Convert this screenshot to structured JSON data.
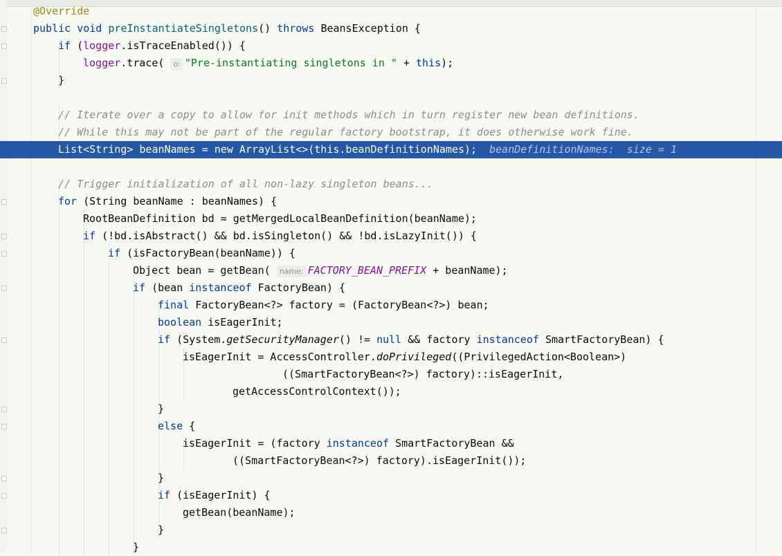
{
  "editor": {
    "language": "Java",
    "current_line_color": "#2557a6",
    "lines": [
      {
        "name": "line-override",
        "indent": 0,
        "tokens": [
          [
            "a",
            "@Override"
          ]
        ]
      },
      {
        "name": "line-method-signature",
        "indent": 0,
        "tokens": [
          [
            "k",
            "public "
          ],
          [
            "k",
            "void "
          ],
          [
            "f",
            "preInstantiateSingletons"
          ],
          [
            "",
            "() "
          ],
          [
            "k",
            "throws "
          ],
          [
            "",
            "BeansException {"
          ]
        ]
      },
      {
        "name": "line-if-trace",
        "indent": 1,
        "tokens": [
          [
            "k",
            "if "
          ],
          [
            "",
            "("
          ],
          [
            "fld",
            "logger"
          ],
          [
            "",
            ".isTraceEnabled()) {"
          ]
        ]
      },
      {
        "name": "line-logger-trace",
        "indent": 2,
        "tokens": [
          [
            "fld",
            "logger"
          ],
          [
            "",
            ".trace( "
          ],
          [
            "hint",
            "o:"
          ],
          [
            "s",
            "\"Pre-instantiating singletons in \""
          ],
          [
            "",
            " + "
          ],
          [
            "k",
            "this"
          ],
          [
            "",
            ");"
          ]
        ]
      },
      {
        "name": "line-close-if-trace",
        "indent": 1,
        "tokens": [
          [
            "",
            "}"
          ]
        ]
      },
      {
        "name": "line-blank-1",
        "indent": 0,
        "tokens": []
      },
      {
        "name": "line-comment-iterate",
        "indent": 1,
        "tokens": [
          [
            "c",
            "// Iterate over a copy to allow for init methods which in turn register new bean definitions."
          ]
        ]
      },
      {
        "name": "line-comment-while",
        "indent": 1,
        "tokens": [
          [
            "c",
            "// While this may not be part of the regular factory bootstrap, it does otherwise work fine."
          ]
        ]
      },
      {
        "name": "line-bean-names",
        "indent": 1,
        "current": true,
        "tokens": [
          [
            "",
            "List<String> beanNames = new ArrayList<>(this.beanDefinitionNames);  "
          ],
          [
            "val",
            "beanDefinitionNames:  size = 1"
          ]
        ]
      },
      {
        "name": "line-blank-2",
        "indent": 0,
        "tokens": []
      },
      {
        "name": "line-comment-trigger",
        "indent": 1,
        "tokens": [
          [
            "c",
            "// Trigger initialization of all non-lazy singleton beans..."
          ]
        ]
      },
      {
        "name": "line-for-loop",
        "indent": 1,
        "tokens": [
          [
            "k",
            "for "
          ],
          [
            "",
            "(String beanName : beanNames) {"
          ]
        ]
      },
      {
        "name": "line-root-bean-def",
        "indent": 2,
        "tokens": [
          [
            "",
            "RootBeanDefinition bd = getMergedLocalBeanDefinition(beanName);"
          ]
        ]
      },
      {
        "name": "line-if-abstract",
        "indent": 2,
        "tokens": [
          [
            "k",
            "if "
          ],
          [
            "",
            "(!bd.isAbstract() && bd.isSingleton() && !bd.isLazyInit()) {"
          ]
        ]
      },
      {
        "name": "line-if-factory-bean",
        "indent": 3,
        "tokens": [
          [
            "k",
            "if "
          ],
          [
            "",
            "(isFactoryBean(beanName)) {"
          ]
        ]
      },
      {
        "name": "line-object-bean",
        "indent": 4,
        "tokens": [
          [
            "",
            "Object bean = getBean( "
          ],
          [
            "hint",
            "name:"
          ],
          [
            "cst",
            "FACTORY_BEAN_PREFIX"
          ],
          [
            "",
            " + beanName);"
          ]
        ]
      },
      {
        "name": "line-if-instanceof",
        "indent": 4,
        "tokens": [
          [
            "k",
            "if "
          ],
          [
            "",
            "(bean "
          ],
          [
            "k",
            "instanceof "
          ],
          [
            "",
            "FactoryBean) {"
          ]
        ]
      },
      {
        "name": "line-final-factory",
        "indent": 5,
        "tokens": [
          [
            "k",
            "final "
          ],
          [
            "",
            "FactoryBean<?> factory = (FactoryBean<?>) bean;"
          ]
        ]
      },
      {
        "name": "line-boolean-eager",
        "indent": 5,
        "tokens": [
          [
            "k",
            "boolean "
          ],
          [
            "",
            "isEagerInit;"
          ]
        ]
      },
      {
        "name": "line-if-security",
        "indent": 5,
        "tokens": [
          [
            "k",
            "if "
          ],
          [
            "",
            "(System."
          ],
          [
            "st",
            "getSecurityManager"
          ],
          [
            "",
            "() != "
          ],
          [
            "k",
            "null "
          ],
          [
            "",
            "&& factory "
          ],
          [
            "k",
            "instanceof "
          ],
          [
            "",
            "SmartFactoryBean) {"
          ]
        ]
      },
      {
        "name": "line-eager-privileged",
        "indent": 6,
        "tokens": [
          [
            "",
            "isEagerInit = AccessController."
          ],
          [
            "st",
            "doPrivileged"
          ],
          [
            "",
            "((PrivilegedAction<Boolean>)"
          ]
        ]
      },
      {
        "name": "line-smart-factory-cast",
        "indent": 10,
        "tokens": [
          [
            "",
            "((SmartFactoryBean<?>) factory)::isEagerInit,"
          ]
        ]
      },
      {
        "name": "line-access-context",
        "indent": 8,
        "tokens": [
          [
            "",
            "getAccessControlContext());"
          ]
        ]
      },
      {
        "name": "line-close-if-security",
        "indent": 5,
        "tokens": [
          [
            "",
            "}"
          ]
        ]
      },
      {
        "name": "line-else",
        "indent": 5,
        "tokens": [
          [
            "k",
            "else "
          ],
          [
            "",
            "{"
          ]
        ]
      },
      {
        "name": "line-eager-instanceof",
        "indent": 6,
        "tokens": [
          [
            "",
            "isEagerInit = (factory "
          ],
          [
            "k",
            "instanceof "
          ],
          [
            "",
            "SmartFactoryBean &&"
          ]
        ]
      },
      {
        "name": "line-eager-call",
        "indent": 8,
        "tokens": [
          [
            "",
            "((SmartFactoryBean<?>) factory).isEagerInit());"
          ]
        ]
      },
      {
        "name": "line-close-else",
        "indent": 5,
        "tokens": [
          [
            "",
            "}"
          ]
        ]
      },
      {
        "name": "line-if-eager",
        "indent": 5,
        "tokens": [
          [
            "k",
            "if "
          ],
          [
            "",
            "(isEagerInit) {"
          ]
        ]
      },
      {
        "name": "line-get-bean",
        "indent": 6,
        "tokens": [
          [
            "",
            "getBean(beanName);"
          ]
        ]
      },
      {
        "name": "line-close-if-eager",
        "indent": 5,
        "tokens": [
          [
            "",
            "}"
          ]
        ]
      },
      {
        "name": "line-close-if-instanceof",
        "indent": 4,
        "tokens": [
          [
            "",
            "}"
          ]
        ]
      }
    ]
  }
}
